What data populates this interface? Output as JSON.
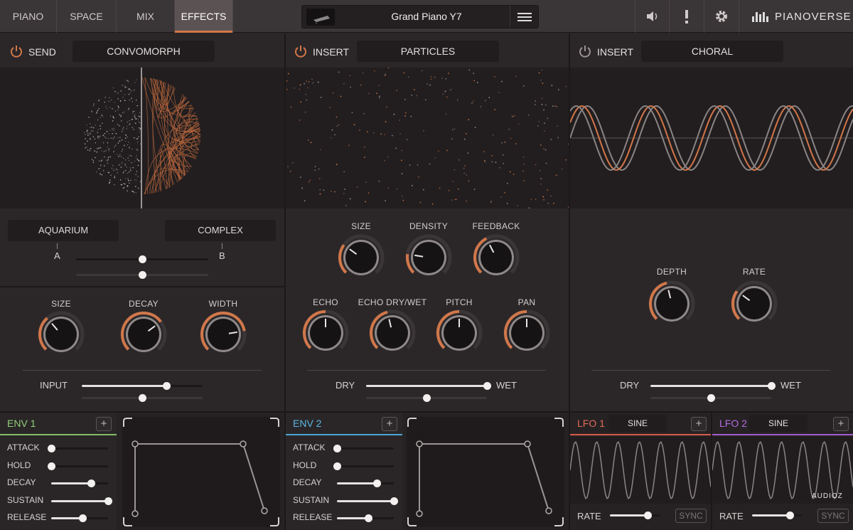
{
  "colors": {
    "accent": "#d2774a",
    "env1": "#7fbf6a",
    "env2": "#4aa7d6",
    "lfo1": "#d65a4a",
    "lfo2": "#a35ad0"
  },
  "topbar": {
    "tabs": [
      {
        "label": "PIANO"
      },
      {
        "label": "SPACE"
      },
      {
        "label": "MIX"
      },
      {
        "label": "EFFECTS",
        "active": true
      }
    ],
    "preset_name": "Grand Piano Y7",
    "brand": "PIANOVERSE",
    "icons": [
      "menu-icon",
      "speaker-icon",
      "alert-icon",
      "gear-icon"
    ]
  },
  "send": {
    "label": "SEND",
    "name": "CONVOMORPH",
    "morph_a": "AQUARIUM",
    "morph_b": "COMPLEX",
    "a": "A",
    "b": "B",
    "morph_value": 0.5,
    "morph_mod": 0.5,
    "knobs": [
      {
        "label": "SIZE",
        "value": 0.35
      },
      {
        "label": "DECAY",
        "value": 0.7
      },
      {
        "label": "WIDTH",
        "value": 0.8
      }
    ],
    "input_label": "INPUT",
    "input_value": 0.7,
    "input_mod": 0.5
  },
  "insert1": {
    "label": "INSERT",
    "name": "PARTICLES",
    "knobs_top": [
      {
        "label": "SIZE",
        "value": 0.3
      },
      {
        "label": "DENSITY",
        "value": 0.2
      },
      {
        "label": "FEEDBACK",
        "value": 0.4
      }
    ],
    "knobs_bottom": [
      {
        "label": "ECHO",
        "value": 0.5
      },
      {
        "label": "ECHO DRY/WET",
        "value": 0.45
      },
      {
        "label": "PITCH",
        "value": 0.5
      },
      {
        "label": "PAN",
        "value": 0.5
      }
    ],
    "dry": "DRY",
    "wet": "WET",
    "drywet": 1.0,
    "drywet_mod": 0.5
  },
  "insert2": {
    "label": "INSERT",
    "name": "CHORAL",
    "knobs": [
      {
        "label": "DEPTH",
        "value": 0.45
      },
      {
        "label": "RATE",
        "value": 0.3
      }
    ],
    "dry": "DRY",
    "wet": "WET",
    "drywet": 1.0,
    "drywet_mod": 0.5
  },
  "env1": {
    "title": "ENV 1",
    "plus": "+",
    "rows": [
      {
        "label": "ATTACK",
        "value": 0.0
      },
      {
        "label": "HOLD",
        "value": 0.0
      },
      {
        "label": "DECAY",
        "value": 0.7
      },
      {
        "label": "SUSTAIN",
        "value": 1.0
      },
      {
        "label": "RELEASE",
        "value": 0.55
      }
    ]
  },
  "env2": {
    "title": "ENV 2",
    "plus": "+",
    "rows": [
      {
        "label": "ATTACK",
        "value": 0.0
      },
      {
        "label": "HOLD",
        "value": 0.0
      },
      {
        "label": "DECAY",
        "value": 0.7
      },
      {
        "label": "SUSTAIN",
        "value": 1.0
      },
      {
        "label": "RELEASE",
        "value": 0.55
      }
    ]
  },
  "lfo1": {
    "title": "LFO 1",
    "shape": "SINE",
    "plus": "+",
    "rate_label": "RATE",
    "rate": 0.75,
    "sync": "SYNC"
  },
  "lfo2": {
    "title": "LFO 2",
    "shape": "SINE",
    "plus": "+",
    "rate_label": "RATE",
    "rate": 0.75,
    "sync": "SYNC"
  },
  "watermark": "AUDIOZ"
}
